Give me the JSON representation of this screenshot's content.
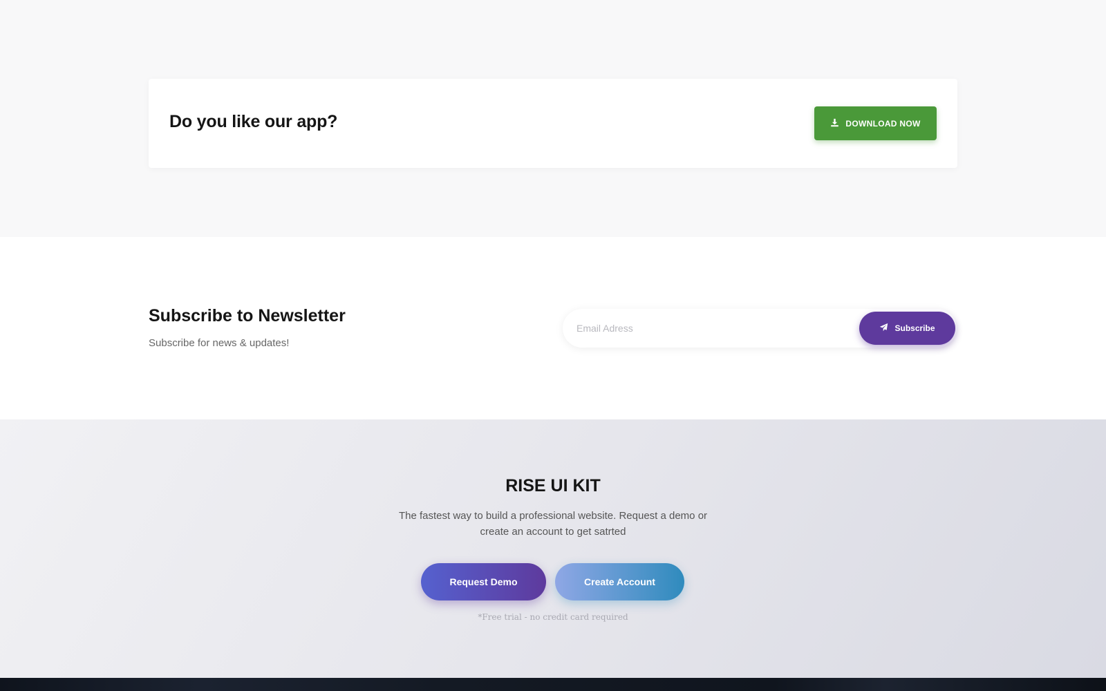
{
  "app_banner": {
    "title": "Do you like our app?",
    "download_label": "DOWNLOAD NOW",
    "download_icon": "download-icon",
    "accent": "#4a9939"
  },
  "newsletter": {
    "title": "Subscribe to Newsletter",
    "subtitle": "Subscribe for news & updates!",
    "email_placeholder": "Email Adress",
    "email_value": "",
    "subscribe_label": "Subscribe",
    "subscribe_icon": "paper-plane-icon",
    "accent": "#5e3a9d"
  },
  "cta": {
    "title": "RISE UI KIT",
    "description": "The fastest way to build a professional website. Request a demo or create an account to get satrted",
    "request_demo_label": "Request Demo",
    "create_account_label": "Create Account",
    "note": "*Free trial - no credit card required"
  }
}
